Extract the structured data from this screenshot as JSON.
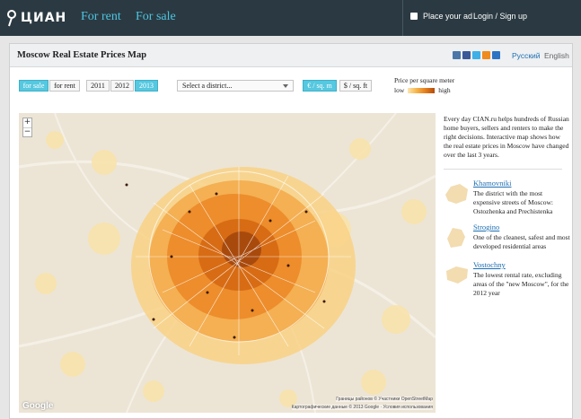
{
  "topbar": {
    "logo_text": "ЦИАН",
    "nav": [
      "For rent",
      "For sale"
    ],
    "place_ad": "Place your ad",
    "login": "Login / Sign up"
  },
  "header": {
    "title": "Moscow Real Estate Prices Map",
    "social_icons": [
      "vk-icon",
      "facebook-icon",
      "twitter-icon",
      "odnoklassniki-icon",
      "mailru-icon"
    ],
    "languages": [
      "Русский",
      "English"
    ]
  },
  "controls": {
    "deal_types": [
      "for sale",
      "for rent"
    ],
    "years": [
      "2011",
      "2012",
      "2013"
    ],
    "district_placeholder": "Select a district...",
    "units": [
      "€ / sq. m",
      "$ / sq. ft"
    ],
    "legend_title": "Price per square meter",
    "legend_low": "low",
    "legend_high": "high"
  },
  "map": {
    "attribution_1": "Границы районов © Участники OpenStreetMap",
    "attribution_2": "Картографические данные © 2013 Google · Условия использования",
    "google_logo": "Google",
    "zoom_in": "+",
    "zoom_out": "−"
  },
  "side": {
    "intro": "Every day CIAN.ru helps hundreds of Russian home buyers, sellers and renters to make the right decisions. Interactive map shows how the real estate prices in Moscow have changed over the last 3 years.",
    "districts": [
      {
        "name": "Khamovniki",
        "desc": "The district with the most expensive streets of Moscow: Ostozhenka and Prechistenka"
      },
      {
        "name": "Strogino",
        "desc": "One of the cleanest, safest and most developed residential areas"
      },
      {
        "name": "Vostochny",
        "desc": "The lowest rental rate, excluding areas of the \"new Moscow\", for the 2012 year"
      }
    ]
  },
  "colors": {
    "topbar": "#2b3a42",
    "accent": "#56c8e0",
    "link": "#1f6fb2",
    "price_low": "#fbe7b0",
    "price_high": "#b24c0c"
  }
}
